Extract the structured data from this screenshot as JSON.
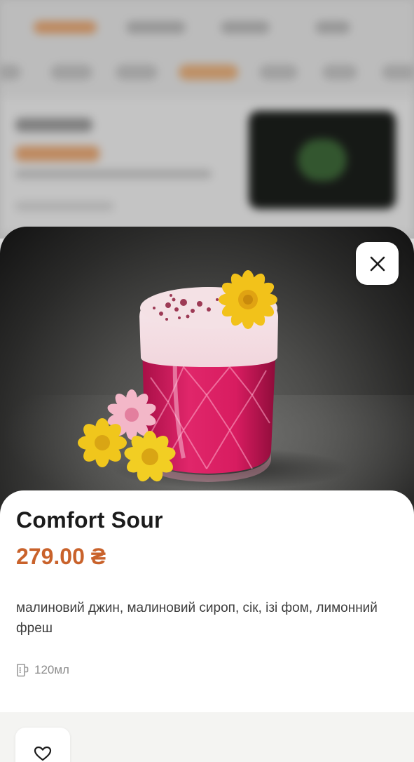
{
  "product": {
    "name": "Comfort Sour",
    "price": "279.00 ₴",
    "description": "малиновий джин, малиновий сироп, сік, ізі фом, лимонний фреш",
    "volume": "120мл"
  },
  "icons": {
    "close": "close-icon",
    "volume": "glass-measure-icon",
    "favorite": "heart-icon"
  },
  "colors": {
    "accent": "#c9622b",
    "drink": "#d6195a"
  }
}
